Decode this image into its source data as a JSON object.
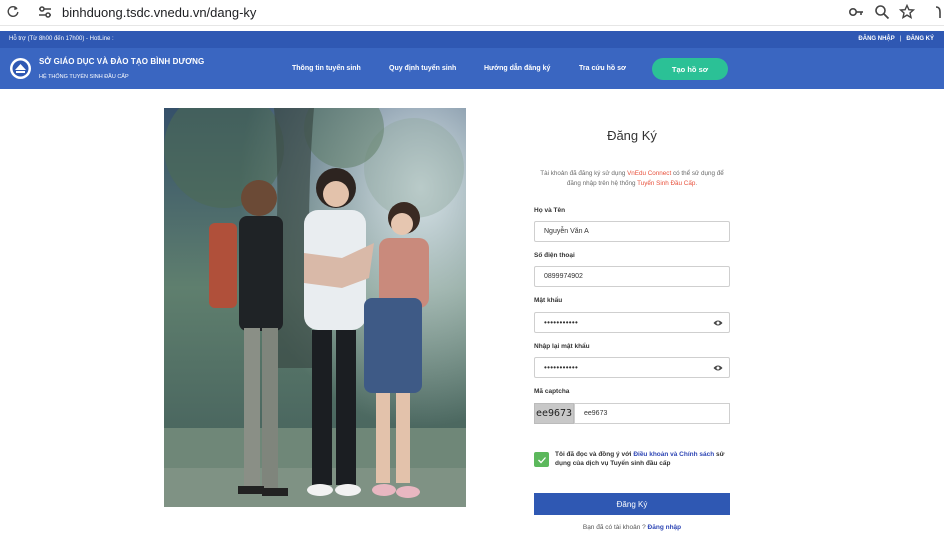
{
  "browser": {
    "url": "binhduong.tsdc.vnedu.vn/dang-ky"
  },
  "topbar": {
    "support": "Hỗ trợ (Từ 8h00 đến 17h00) - HotLine :",
    "login": "ĐĂNG NHẬP",
    "separator": "|",
    "register": "ĐĂNG KÝ"
  },
  "header": {
    "title": "SỞ GIÁO DỤC VÀ ĐÀO TẠO BÌNH DƯƠNG",
    "subtitle": "HỆ THỐNG TUYỂN SINH ĐẦU CẤP",
    "nav": [
      {
        "label": "Thông tin tuyển sinh"
      },
      {
        "label": "Quy định tuyển sinh"
      },
      {
        "label": "Hướng dẫn đăng ký"
      },
      {
        "label": "Tra cứu hồ sơ"
      }
    ],
    "create_button": "Tạo hồ sơ"
  },
  "form": {
    "title": "Đăng Ký",
    "note_part1": "Tài khoản đã đăng ký sử dụng ",
    "note_hl1": "VnEdu Connect",
    "note_part2": " có thể sử dụng để đăng nhập trên hệ thống ",
    "note_hl2": "Tuyển Sinh Đầu Cấp",
    "note_part3": ".",
    "fullname_label": "Họ và Tên",
    "fullname_value": "Nguyễn Văn A",
    "phone_label": "Số điện thoại",
    "phone_value": "0899974902",
    "password_label": "Mật khẩu",
    "password_value": "•••••••••••",
    "confirm_label": "Nhập lại mật khẩu",
    "confirm_value": "•••••••••••",
    "captcha_label": "Mã captcha",
    "captcha_image_text": "ee9673",
    "captcha_value": "ee9673",
    "agree_part1": "Tôi đã đọc và đồng ý với ",
    "agree_link": "Điều khoản và Chính sách",
    "agree_part2": " sử dụng của dịch vụ Tuyển sinh đầu cấp",
    "agree_checked": true,
    "submit_label": "Đăng Ký",
    "has_account": "Bạn đã có tài khoản ? ",
    "login_link": "Đăng nhập"
  },
  "colors": {
    "header_bg": "#3a66c1",
    "topbar_bg": "#2f58b3",
    "accent_green": "#2bc196",
    "highlight_red": "#e8513c",
    "link_blue": "#2f47b5"
  },
  "icons": [
    "reload-icon",
    "site-info-icon",
    "key-icon",
    "zoom-icon",
    "star-icon",
    "eye-icon",
    "check-icon"
  ]
}
